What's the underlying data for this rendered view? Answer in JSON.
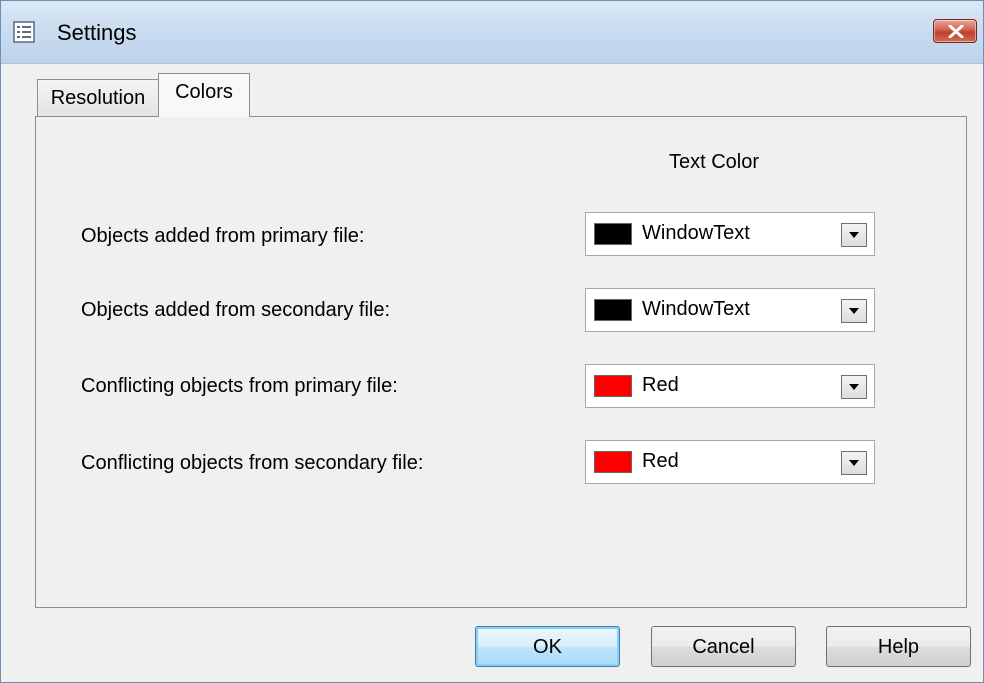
{
  "window": {
    "title": "Settings",
    "icon": "settings-list-icon"
  },
  "tabs": [
    {
      "label": "Resolution",
      "selected": false
    },
    {
      "label": "Colors",
      "selected": true
    }
  ],
  "colors_panel": {
    "column_header": "Text Color",
    "rows": [
      {
        "label": "Objects added from primary file:",
        "value": "WindowText",
        "swatch": "#000000"
      },
      {
        "label": "Objects added from secondary file:",
        "value": "WindowText",
        "swatch": "#000000"
      },
      {
        "label": "Conflicting objects from primary file:",
        "value": "Red",
        "swatch": "#ff0000"
      },
      {
        "label": "Conflicting objects from secondary file:",
        "value": "Red",
        "swatch": "#ff0000"
      }
    ]
  },
  "buttons": {
    "ok": "OK",
    "cancel": "Cancel",
    "help": "Help"
  },
  "colors": {
    "close_button": "#c7432f",
    "default_button_border": "#3c7fb1"
  }
}
